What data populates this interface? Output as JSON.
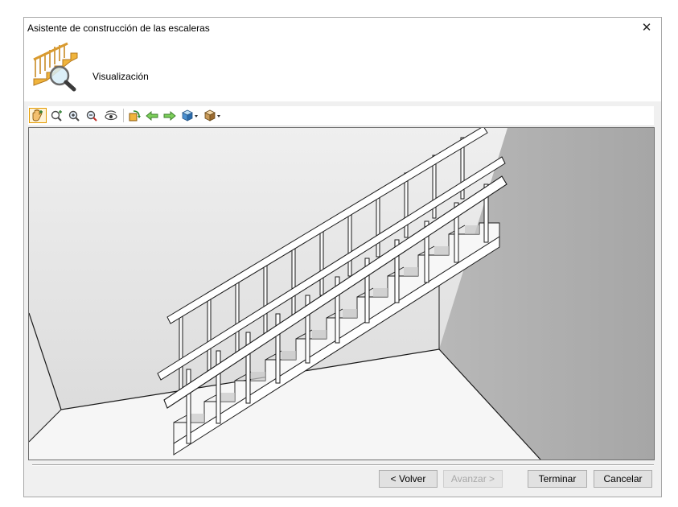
{
  "window": {
    "title": "Asistente de construcción de las escaleras"
  },
  "header": {
    "step_title": "Visualización",
    "icon": "staircase-magnifier-icon"
  },
  "toolbar": {
    "items": [
      {
        "icon": "pan-hand-icon",
        "active": true
      },
      {
        "icon": "zoom-window-icon"
      },
      {
        "icon": "zoom-in-icon"
      },
      {
        "icon": "zoom-out-icon"
      },
      {
        "icon": "orbit-eye-icon"
      },
      {
        "icon": "rotate-view-icon"
      },
      {
        "icon": "arrow-left-icon"
      },
      {
        "icon": "arrow-right-icon"
      },
      {
        "icon": "view-cube-dropdown-icon"
      },
      {
        "icon": "render-style-dropdown-icon"
      }
    ]
  },
  "buttons": {
    "back": "< Volver",
    "next": "Avanzar >",
    "finish": "Terminar",
    "cancel": "Cancelar"
  },
  "colors": {
    "accent": "#0078d7",
    "active_tool": "#e59b00",
    "stair_fill": "#f7f7f7"
  }
}
